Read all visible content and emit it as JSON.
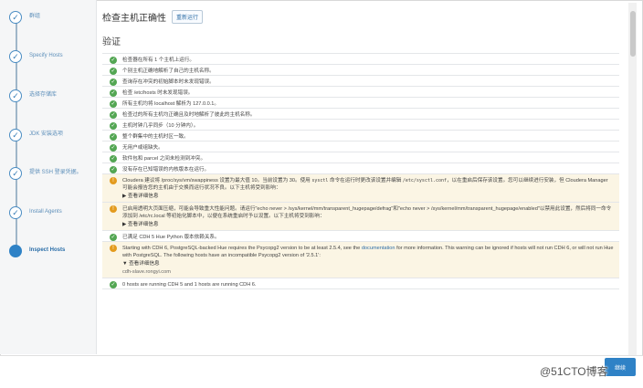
{
  "sidebar": {
    "steps": [
      {
        "label": "群组"
      },
      {
        "label": "Specify Hosts"
      },
      {
        "label": "选择存储库"
      },
      {
        "label": "JDK 安装选项"
      },
      {
        "label": "提供 SSH 登录凭据。"
      },
      {
        "label": "Install Agents"
      },
      {
        "label": "Inspect Hosts"
      }
    ]
  },
  "header": {
    "title": "检查主机正确性",
    "rerun_label": "重新运行"
  },
  "section": {
    "title": "验证"
  },
  "checks_ok": [
    "检查器在所有 1 个主机上运行。",
    "个别主机正确地解析了自己的主机名称。",
    "查询存在冲突的初始脚本时未发现错误。",
    "检查 /etc/hosts 时未发现错误。",
    "所有主机均将 localhost 解析为 127.0.0.1。",
    "检查过的所有主机均正确且及时地解析了彼此的主机名称。",
    "主机时钟几乎同步（10 分钟内）。",
    "整个群集中的主机时区一致。",
    "无用户或组缺失。",
    "软件包和 parcel 之间未检测到冲突。",
    "没有存在已知错误的内核版本在运行。"
  ],
  "warning_swappiness": {
    "text_a": "Cloudera 建议将 /proc/sys/vm/swappiness 设置为最大值 10。当前设置为 30。使用",
    "code_a": "sysctl",
    "text_b": "命令在运行时更改该设置并编辑",
    "code_b": "/etc/sysctl.conf",
    "text_c": "，以在重启后保存该设置。您可以继续进行安装，但 Cloudera Manager 可能会报告您的主机由于交换而运行状况不良。以下主机将受到影响：",
    "more": "▶ 查看详细信息"
  },
  "warning_thp": {
    "text": "已启用透明大页面压缩，可能会导致重大性能问题。请运行\"echo never > /sys/kernel/mm/transparent_hugepage/defrag\"和\"echo never > /sys/kernel/mm/transparent_hugepage/enabled\"以禁用此设置，然后将同一命令添加到 /etc/rc.local 等初始化脚本中，以便在系统重启时予以设置。以下主机将受到影响：",
    "more": "▶ 查看详细信息"
  },
  "check_python": "已满足 CDH 5 Hue Python 版本依赖关系。",
  "warning_hue": {
    "text_a": "Starting with CDH 6, PostgreSQL-backed Hue requires the Psycopg2 version to be at least 2.5.4, see the",
    "link": "documentation",
    "text_b": "for more information. This warning can be ignored if hosts will not run CDH 6, or will not run Hue with PostgreSQL. The following hosts have an incompatible Psycopg2 version of '2.5.1':",
    "more": "▼ 查看详细信息",
    "host": "cdh-slave.rongyi.com"
  },
  "check_cdh": "0 hosts are running CDH 5 and 1 hosts are running CDH 6.",
  "footer": {
    "continue_label": "继续",
    "watermark": "@51CTO博客"
  }
}
